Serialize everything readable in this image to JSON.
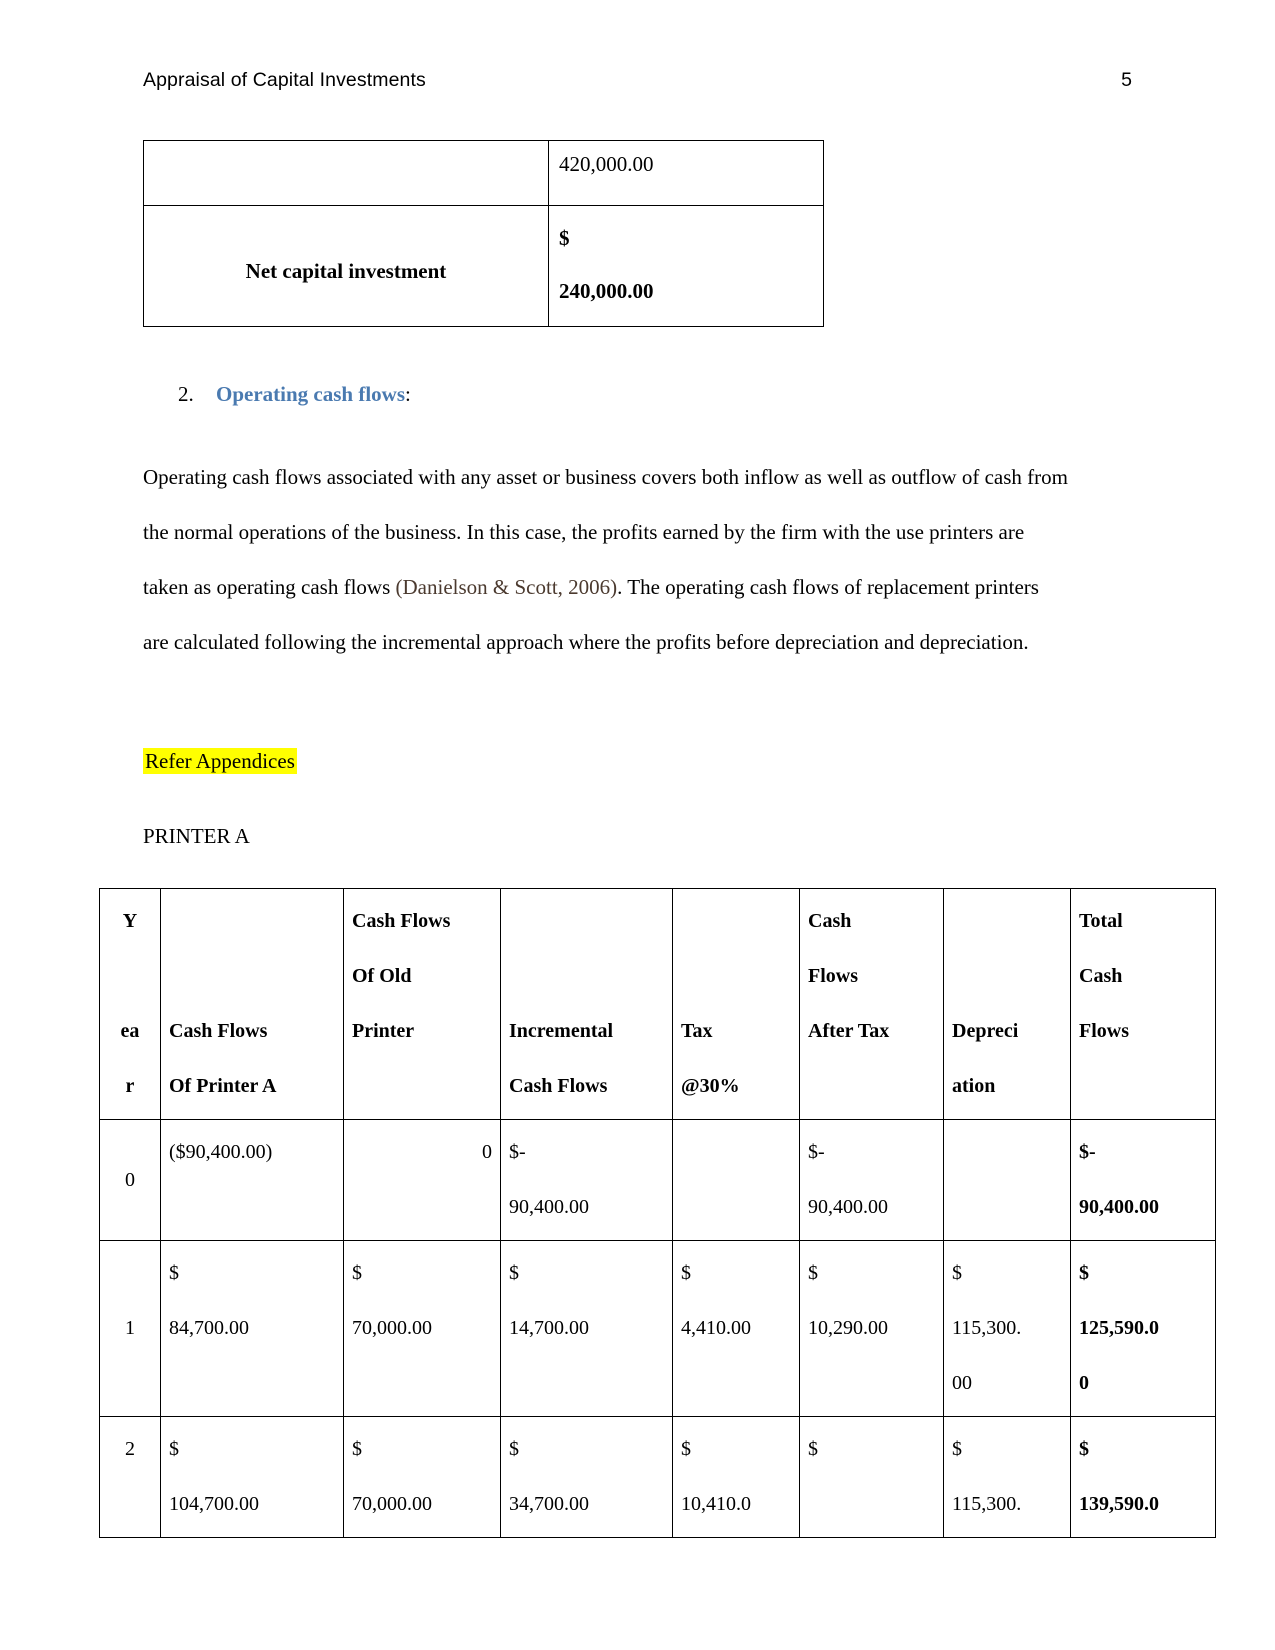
{
  "header": {
    "title": "Appraisal of Capital Investments",
    "page_number": "5"
  },
  "top_table": {
    "rows": [
      {
        "label": "",
        "value_currency": "",
        "value_amount": "420,000.00",
        "bold": false
      },
      {
        "label": "Net capital investment",
        "value_currency": "$",
        "value_amount": "240,000.00",
        "bold": true
      }
    ]
  },
  "heading": {
    "number": "2.",
    "text": "Operating cash flows",
    "colon": ":",
    "color": "#4a7ab0"
  },
  "paragraphs": {
    "p1_part1": "Operating cash flows associated with any asset or business covers both inflow as well as outflow of cash from the normal operations of the business. In this case, the profits earned by the firm with the use printers are taken as operating cash flows ",
    "p1_citation": "(Danielson & Scott, 2006)",
    "p1_part2": ". The operating cash flows of replacement printers are calculated following the incremental approach where the profits before depreciation and depreciation."
  },
  "highlight": {
    "text": "Refer Appendices",
    "color": "#ffff00"
  },
  "printer_label": "PRINTER A",
  "cash_flow_table": {
    "headers": [
      {
        "line1": "Y",
        "line2": "ea",
        "line3": "r"
      },
      {
        "line1": "",
        "line2": "Cash Flows",
        "line3": "Of Printer A"
      },
      {
        "line1": "Cash Flows",
        "line2": "Of Old",
        "line3": "Printer"
      },
      {
        "line1": "",
        "line2": "Incremental",
        "line3": "Cash Flows"
      },
      {
        "line1": "",
        "line2": "Tax",
        "line3": "@30%"
      },
      {
        "line1": "Cash",
        "line2": "Flows",
        "line3": "After Tax"
      },
      {
        "line1": "",
        "line2": "Depreci",
        "line3": "ation"
      },
      {
        "line1": "Total",
        "line2": "Cash",
        "line3": "Flows"
      }
    ],
    "rows": [
      {
        "year": "0",
        "cash_flows_printer_a": "($90,400.00)",
        "cash_flows_old_printer": "0",
        "incremental_currency": "$",
        "incremental_dash": "-",
        "incremental_amount": "90,400.00",
        "tax": "",
        "after_tax_currency": "$",
        "after_tax_dash": "-",
        "after_tax_amount": "90,400.00",
        "depreciation": "",
        "total_currency": "$",
        "total_dash": "-",
        "total_amount": "90,400.00"
      },
      {
        "year": "1",
        "cf_a_currency": "$",
        "cf_a_amount": "84,700.00",
        "cf_old_currency": "$",
        "cf_old_amount": "70,000.00",
        "incr_currency": "$",
        "incr_amount": "14,700.00",
        "tax_currency": "$",
        "tax_amount": "4,410.00",
        "after_tax_currency": "$",
        "after_tax_amount": "10,290.00",
        "depr_currency": "$",
        "depr_amount1": "115,300.",
        "depr_amount2": "00",
        "total_currency": "$",
        "total_amount1": "125,590.0",
        "total_amount2": "0"
      },
      {
        "year": "2",
        "cf_a_currency": "$",
        "cf_a_amount": "104,700.00",
        "cf_old_currency": "$",
        "cf_old_amount": "70,000.00",
        "incr_currency": "$",
        "incr_amount": "34,700.00",
        "tax_currency": "$",
        "tax_amount": "10,410.0",
        "after_tax_currency": "$",
        "after_tax_amount": "",
        "depr_currency": "$",
        "depr_amount1": "115,300.",
        "depr_amount2": "",
        "total_currency": "$",
        "total_amount1": "139,590.0",
        "total_amount2": ""
      }
    ]
  }
}
